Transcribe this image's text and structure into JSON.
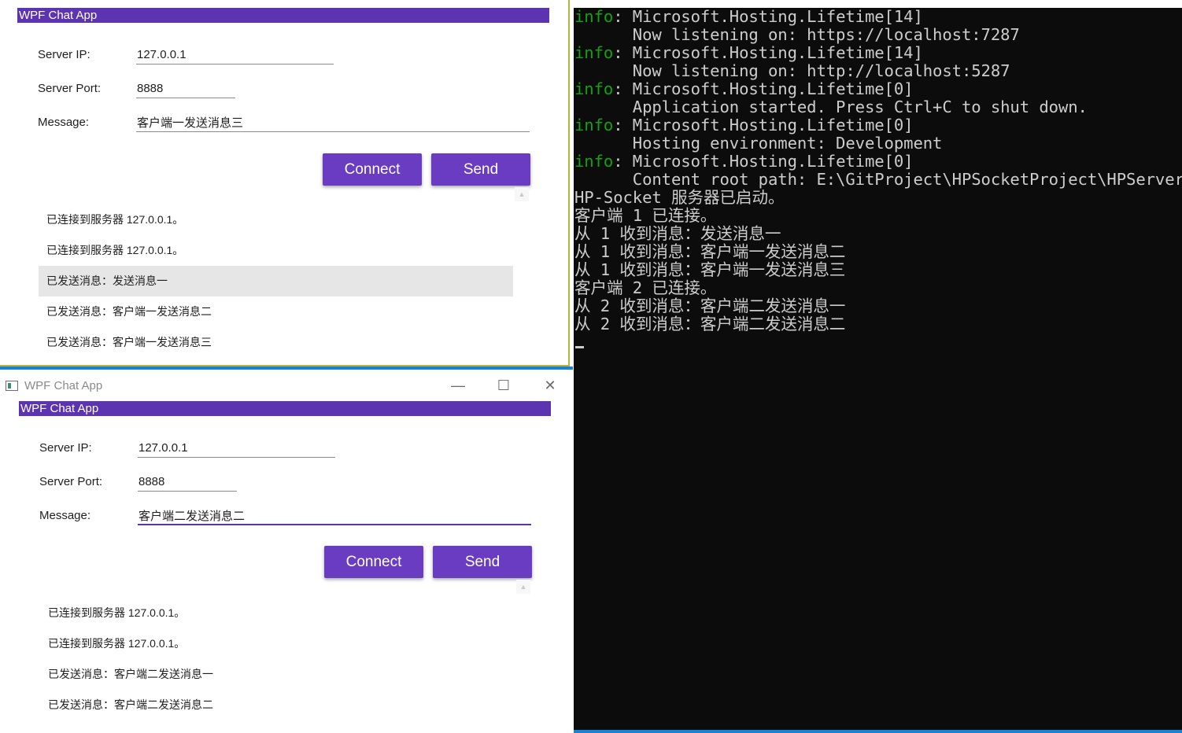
{
  "client1": {
    "app_banner": "WPF Chat App",
    "server_ip_label": "Server IP:",
    "server_ip_value": "127.0.0.1",
    "server_port_label": "Server Port:",
    "server_port_value": "8888",
    "message_label": "Message:",
    "message_value": "客户端一发送消息三",
    "connect_label": "Connect",
    "send_label": "Send",
    "log": [
      "已连接到服务器 127.0.0.1。",
      "已连接到服务器 127.0.0.1。",
      "已发送消息：发送消息一",
      "已发送消息：客户端一发送消息二",
      "已发送消息：客户端一发送消息三"
    ]
  },
  "client2": {
    "window_title": "WPF Chat App",
    "app_banner": "WPF Chat App",
    "server_ip_label": "Server IP:",
    "server_ip_value": "127.0.0.1",
    "server_port_label": "Server Port:",
    "server_port_value": "8888",
    "message_label": "Message:",
    "message_value": "客户端二发送消息二",
    "connect_label": "Connect",
    "send_label": "Send",
    "log": [
      "已连接到服务器 127.0.0.1。",
      "已连接到服务器 127.0.0.1。",
      "已发送消息：客户端二发送消息一",
      "已发送消息：客户端二发送消息二"
    ]
  },
  "console": {
    "lines": [
      {
        "level": "info",
        "text": ": Microsoft.Hosting.Lifetime[14]"
      },
      {
        "level": "",
        "text": "      Now listening on: https://localhost:7287"
      },
      {
        "level": "info",
        "text": ": Microsoft.Hosting.Lifetime[14]"
      },
      {
        "level": "",
        "text": "      Now listening on: http://localhost:5287"
      },
      {
        "level": "info",
        "text": ": Microsoft.Hosting.Lifetime[0]"
      },
      {
        "level": "",
        "text": "      Application started. Press Ctrl+C to shut down."
      },
      {
        "level": "info",
        "text": ": Microsoft.Hosting.Lifetime[0]"
      },
      {
        "level": "",
        "text": "      Hosting environment: Development"
      },
      {
        "level": "info",
        "text": ": Microsoft.Hosting.Lifetime[0]"
      },
      {
        "level": "",
        "text": "      Content root path: E:\\GitProject\\HPSocketProject\\HPServer\\"
      },
      {
        "level": "",
        "text": "HP-Socket 服务器已启动。"
      },
      {
        "level": "",
        "text": "客户端 1 已连接。"
      },
      {
        "level": "",
        "text": "从 1 收到消息：发送消息一"
      },
      {
        "level": "",
        "text": "从 1 收到消息：客户端一发送消息二"
      },
      {
        "level": "",
        "text": "从 1 收到消息：客户端一发送消息三"
      },
      {
        "level": "",
        "text": "客户端 2 已连接。"
      },
      {
        "level": "",
        "text": "从 2 收到消息：客户端二发送消息一"
      },
      {
        "level": "",
        "text": "从 2 收到消息：客户端二发送消息二"
      }
    ]
  },
  "colors": {
    "accent": "#6a3cc2",
    "banner": "#5c33b0",
    "console_bg": "#0c0c0c",
    "console_text": "#cccccc",
    "console_info": "#13a10e"
  }
}
